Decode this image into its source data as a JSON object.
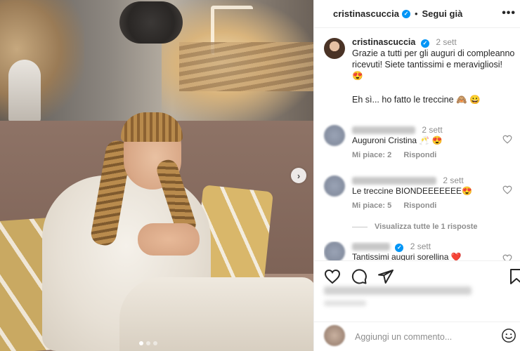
{
  "post": {
    "author": "cristinascuccia",
    "follow_label": "Segui già",
    "separator": "•",
    "time": "2 sett",
    "caption_line1": "Grazie a tutti per gli auguri di compleanno ricevuti! Siete tantissimi e meravigliosi! 😍",
    "caption_line2": "Eh sì... ho fatto le treccine 🙈 😀"
  },
  "comments": [
    {
      "time": "2 sett",
      "text": "Auguroni Cristina 🥂 😍",
      "likes": "Mi piace: 2",
      "reply": "Rispondi"
    },
    {
      "time": "2 sett",
      "text": "Le treccine BIONDEEEEEEE😍",
      "likes": "Mi piace: 5",
      "reply": "Rispondi"
    },
    {
      "time": "2 sett",
      "text": "Tantissimi auguri sorellina ❤️"
    }
  ],
  "view_replies": "Visualizza tutte le 1 risposte",
  "add_comment": {
    "placeholder": "Aggiungi un commento..."
  },
  "carousel": {
    "dots": 3,
    "active_index": 0
  },
  "colors": {
    "verified": "#0095f6",
    "muted": "#8e8e8e",
    "text": "#262626"
  },
  "icons": [
    "heart-icon",
    "comment-icon",
    "share-icon",
    "bookmark-icon",
    "emoji-icon",
    "chevron-right-icon",
    "more-icon",
    "verified-icon"
  ]
}
